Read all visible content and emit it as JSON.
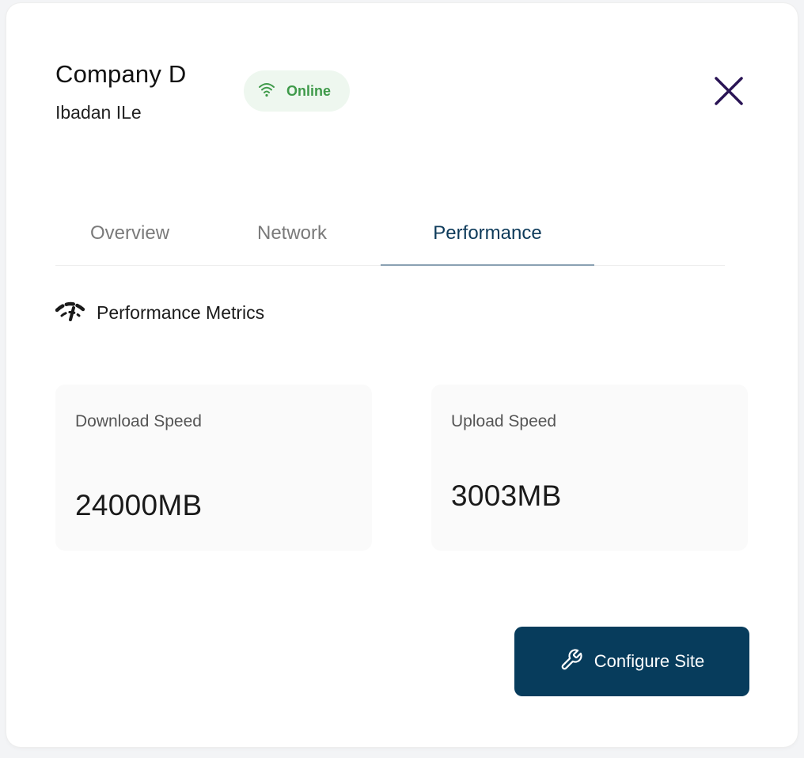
{
  "header": {
    "title": "Company D",
    "subtitle": "Ibadan ILe",
    "status": {
      "label": "Online",
      "icon": "wifi-icon",
      "color": "#3f9a4a"
    },
    "close_icon": "close-icon"
  },
  "tabs": [
    {
      "label": "Overview",
      "active": false
    },
    {
      "label": "Network",
      "active": false
    },
    {
      "label": "Performance",
      "active": true
    }
  ],
  "section": {
    "icon": "speedometer-icon",
    "title": "Performance Metrics"
  },
  "metrics": [
    {
      "label": "Download Speed",
      "value": "24000MB"
    },
    {
      "label": "Upload Speed",
      "value": "3003MB"
    }
  ],
  "actions": {
    "configure_label": "Configure Site",
    "configure_icon": "wrench-icon"
  },
  "colors": {
    "accent": "#073c5c",
    "active_tab": "#0d3a5a",
    "close_icon": "#2a1455",
    "online": "#3f9a4a"
  }
}
